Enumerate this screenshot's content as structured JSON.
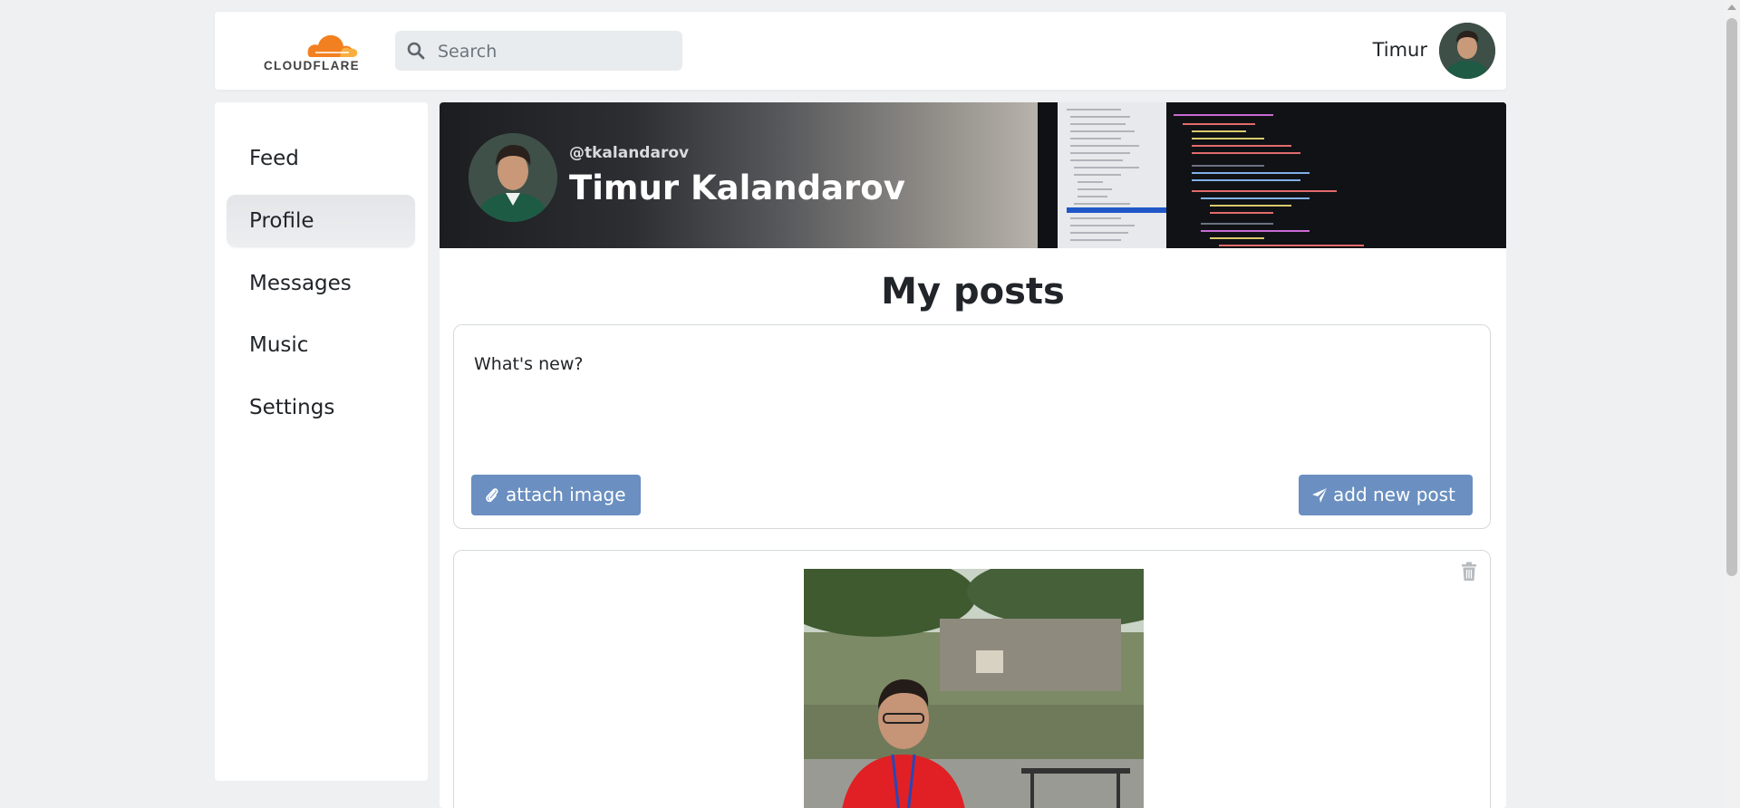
{
  "header": {
    "logo_text": "CLOUDFLARE",
    "search_placeholder": "Search",
    "user_name": "Timur"
  },
  "sidebar": {
    "items": [
      {
        "label": "Feed",
        "active": false
      },
      {
        "label": "Profile",
        "active": true
      },
      {
        "label": "Messages",
        "active": false
      },
      {
        "label": "Music",
        "active": false
      },
      {
        "label": "Settings",
        "active": false
      }
    ]
  },
  "profile": {
    "handle": "@tkalandarov",
    "full_name": "Timur Kalandarov"
  },
  "main": {
    "section_title": "My posts",
    "composer_placeholder": "What's new?",
    "attach_label": "attach image",
    "post_label": "add new post"
  },
  "colors": {
    "accent_button": "#6a8fc0",
    "active_nav_bg": "#e3e5e8",
    "page_bg": "#eef0f2"
  }
}
